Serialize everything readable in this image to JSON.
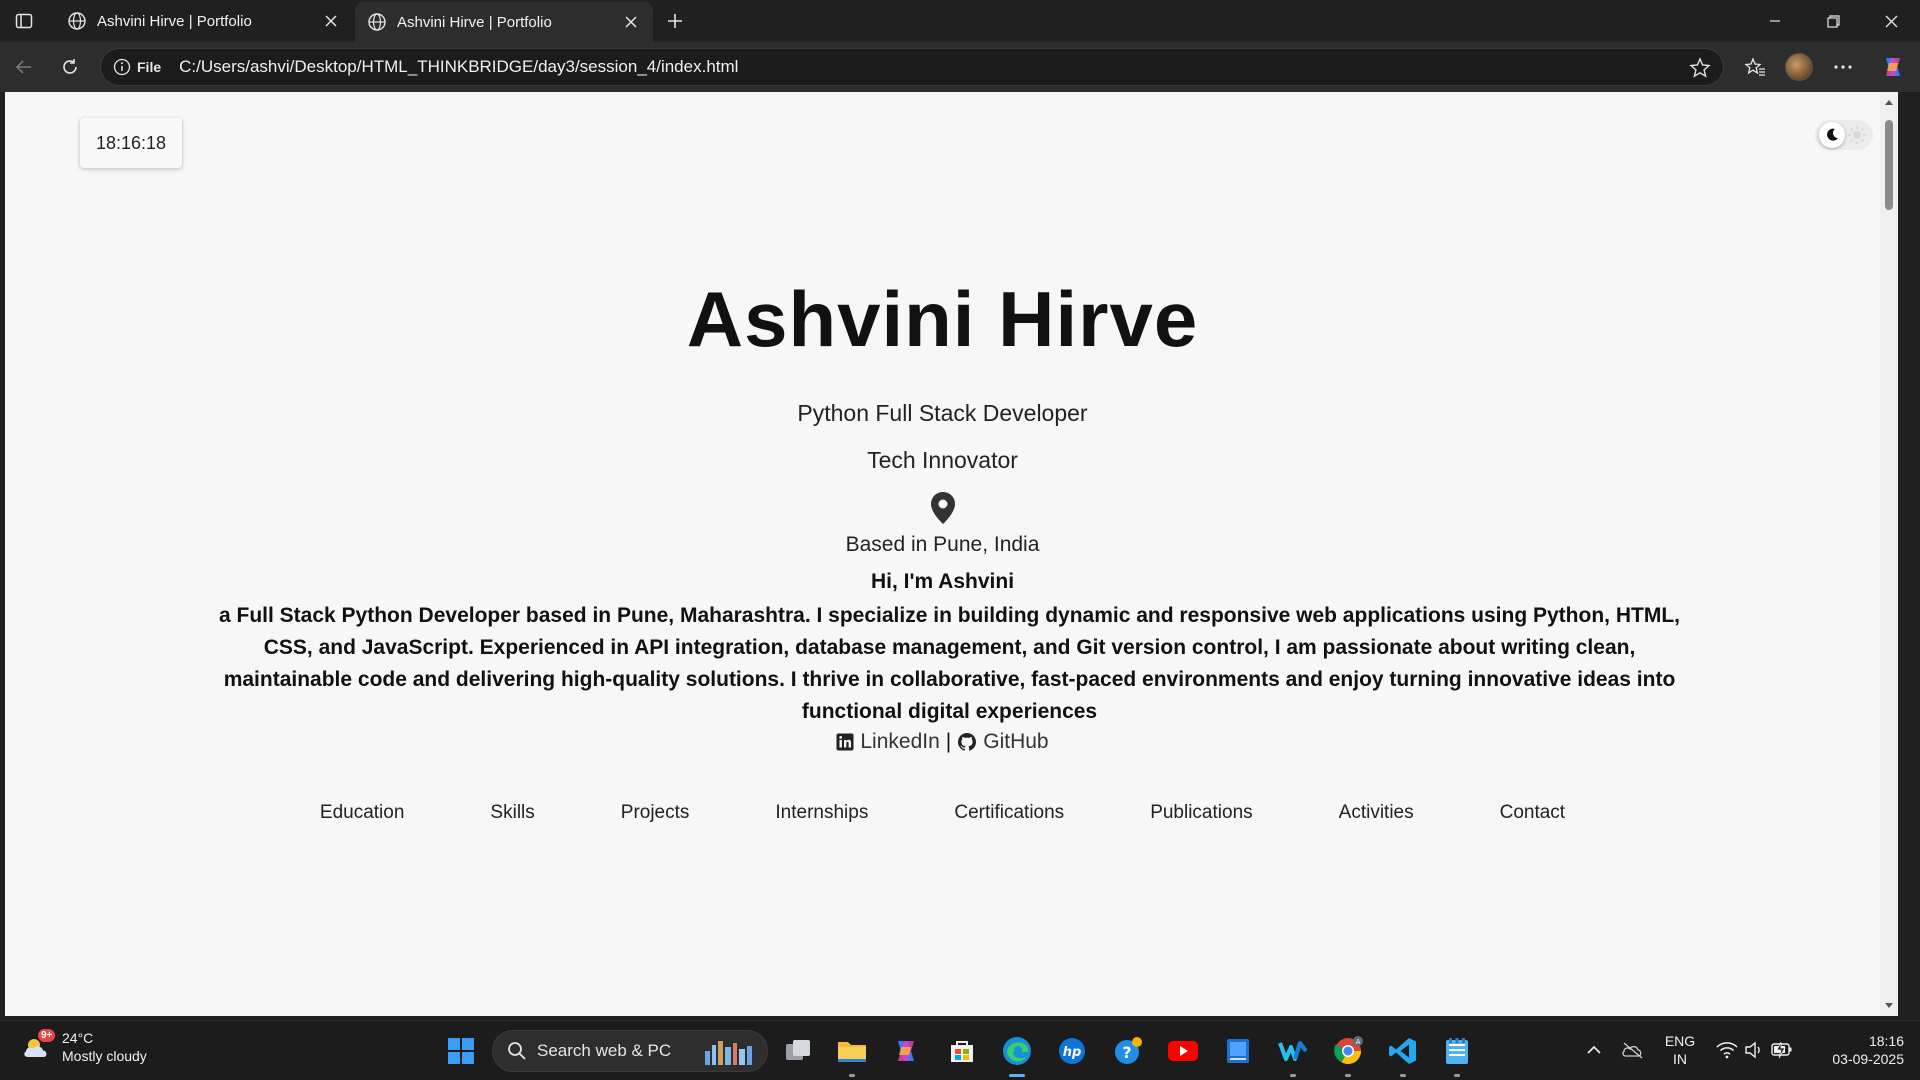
{
  "browser": {
    "tabs": [
      {
        "title": "Ashvini Hirve | Portfolio",
        "active": false
      },
      {
        "title": "Ashvini Hirve | Portfolio",
        "active": true
      }
    ],
    "address": {
      "scheme_label": "File",
      "url": "C:/Users/ashvi/Desktop/HTML_THINKBRIDGE/day3/session_4/index.html"
    }
  },
  "page": {
    "clock": "18:16:18",
    "theme_toggle": {
      "left_icon": "moon-icon",
      "right_icon": "sun-icon"
    },
    "name": "Ashvini Hirve",
    "roles": [
      "Python Full Stack Developer",
      "Tech Innovator"
    ],
    "location": "Based in Pune, India",
    "greeting": "Hi, I'm Ashvini",
    "bio": "a Full Stack Python Developer based in Pune, Maharashtra. I specialize in building dynamic and responsive web applications using Python, HTML, CSS, and JavaScript. Experienced in API integration, database management, and Git version control, I am passionate about writing clean, maintainable code and delivering high-quality solutions. I thrive in collaborative, fast-paced environments and enjoy turning innovative ideas into functional digital experiences",
    "social": {
      "linkedin": "LinkedIn",
      "separator": "|",
      "github": "GitHub"
    },
    "nav": [
      "Education",
      "Skills",
      "Projects",
      "Internships",
      "Certifications",
      "Publications",
      "Activities",
      "Contact"
    ]
  },
  "taskbar": {
    "weather": {
      "badge": "9+",
      "temp": "24°C",
      "condition": "Mostly cloudy"
    },
    "search_placeholder": "Search web & PC",
    "language": {
      "line1": "ENG",
      "line2": "IN"
    },
    "time": "18:16",
    "date": "03-09-2025"
  },
  "colors": {
    "chrome_bg": "#202020",
    "toolbar_bg": "#2d2d2d",
    "page_bg": "#f7f7f7",
    "text": "#111111",
    "accent": "#5fb2ff"
  }
}
